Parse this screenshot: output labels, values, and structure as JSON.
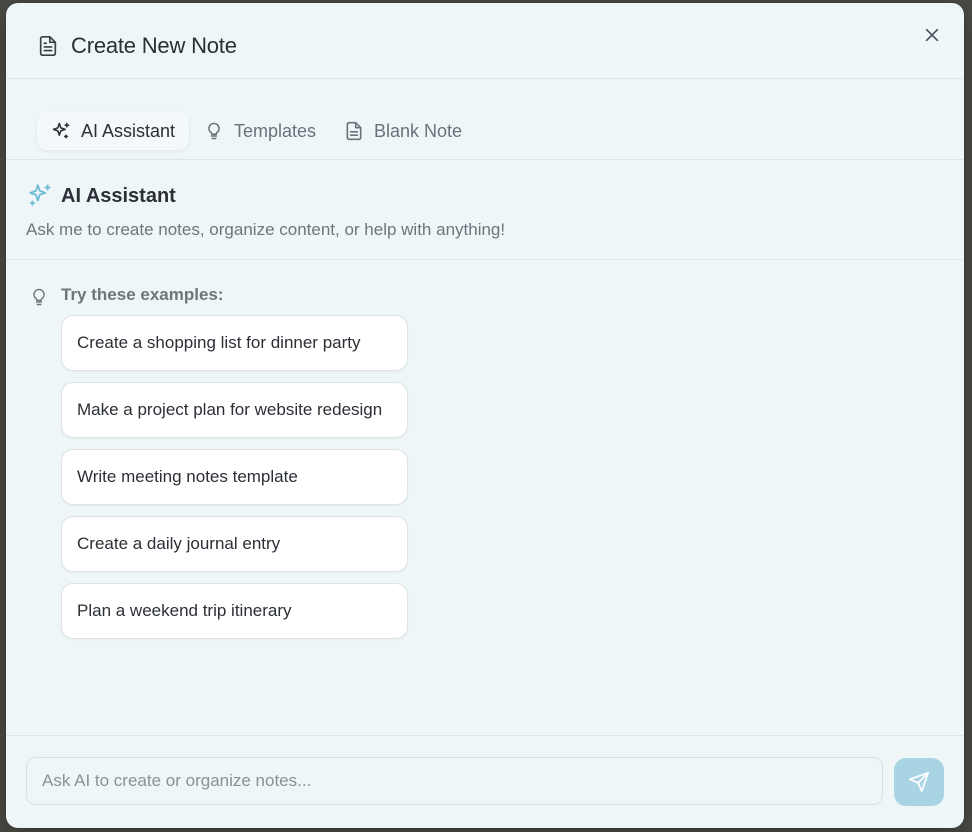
{
  "modal": {
    "title": "Create New Note"
  },
  "tabs": [
    {
      "label": "AI Assistant",
      "icon": "sparkles-icon",
      "active": true
    },
    {
      "label": "Templates",
      "icon": "lightbulb-icon",
      "active": false
    },
    {
      "label": "Blank Note",
      "icon": "document-icon",
      "active": false
    }
  ],
  "assistant": {
    "heading": "AI Assistant",
    "subtitle": "Ask me to create notes, organize content, or help with anything!"
  },
  "examples": {
    "label": "Try these examples:",
    "items": [
      "Create a shopping list for dinner party",
      "Make a project plan for website redesign",
      "Write meeting notes template",
      "Create a daily journal entry",
      "Plan a weekend trip itinerary"
    ]
  },
  "composer": {
    "placeholder": "Ask AI to create or organize notes...",
    "value": ""
  },
  "colors": {
    "accent": "#6fbcd6",
    "send_button": "#a9d4e3",
    "modal_bg": "#eef6f8"
  }
}
